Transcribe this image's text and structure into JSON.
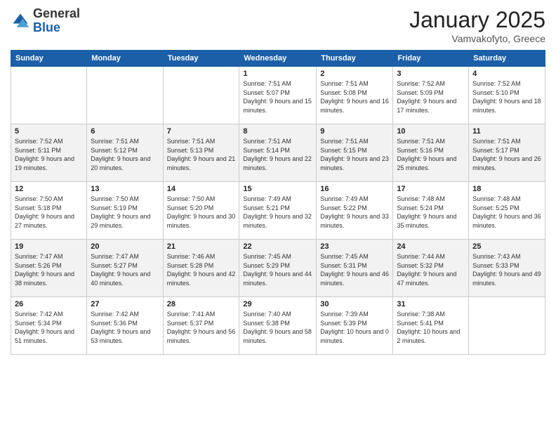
{
  "logo": {
    "general": "General",
    "blue": "Blue"
  },
  "title": "January 2025",
  "subtitle": "Vamvakofyto, Greece",
  "days_header": [
    "Sunday",
    "Monday",
    "Tuesday",
    "Wednesday",
    "Thursday",
    "Friday",
    "Saturday"
  ],
  "weeks": [
    [
      {
        "day": "",
        "sunrise": "",
        "sunset": "",
        "daylight": ""
      },
      {
        "day": "",
        "sunrise": "",
        "sunset": "",
        "daylight": ""
      },
      {
        "day": "",
        "sunrise": "",
        "sunset": "",
        "daylight": ""
      },
      {
        "day": "1",
        "sunrise": "Sunrise: 7:51 AM",
        "sunset": "Sunset: 5:07 PM",
        "daylight": "Daylight: 9 hours and 15 minutes."
      },
      {
        "day": "2",
        "sunrise": "Sunrise: 7:51 AM",
        "sunset": "Sunset: 5:08 PM",
        "daylight": "Daylight: 9 hours and 16 minutes."
      },
      {
        "day": "3",
        "sunrise": "Sunrise: 7:52 AM",
        "sunset": "Sunset: 5:09 PM",
        "daylight": "Daylight: 9 hours and 17 minutes."
      },
      {
        "day": "4",
        "sunrise": "Sunrise: 7:52 AM",
        "sunset": "Sunset: 5:10 PM",
        "daylight": "Daylight: 9 hours and 18 minutes."
      }
    ],
    [
      {
        "day": "5",
        "sunrise": "Sunrise: 7:52 AM",
        "sunset": "Sunset: 5:11 PM",
        "daylight": "Daylight: 9 hours and 19 minutes."
      },
      {
        "day": "6",
        "sunrise": "Sunrise: 7:51 AM",
        "sunset": "Sunset: 5:12 PM",
        "daylight": "Daylight: 9 hours and 20 minutes."
      },
      {
        "day": "7",
        "sunrise": "Sunrise: 7:51 AM",
        "sunset": "Sunset: 5:13 PM",
        "daylight": "Daylight: 9 hours and 21 minutes."
      },
      {
        "day": "8",
        "sunrise": "Sunrise: 7:51 AM",
        "sunset": "Sunset: 5:14 PM",
        "daylight": "Daylight: 9 hours and 22 minutes."
      },
      {
        "day": "9",
        "sunrise": "Sunrise: 7:51 AM",
        "sunset": "Sunset: 5:15 PM",
        "daylight": "Daylight: 9 hours and 23 minutes."
      },
      {
        "day": "10",
        "sunrise": "Sunrise: 7:51 AM",
        "sunset": "Sunset: 5:16 PM",
        "daylight": "Daylight: 9 hours and 25 minutes."
      },
      {
        "day": "11",
        "sunrise": "Sunrise: 7:51 AM",
        "sunset": "Sunset: 5:17 PM",
        "daylight": "Daylight: 9 hours and 26 minutes."
      }
    ],
    [
      {
        "day": "12",
        "sunrise": "Sunrise: 7:50 AM",
        "sunset": "Sunset: 5:18 PM",
        "daylight": "Daylight: 9 hours and 27 minutes."
      },
      {
        "day": "13",
        "sunrise": "Sunrise: 7:50 AM",
        "sunset": "Sunset: 5:19 PM",
        "daylight": "Daylight: 9 hours and 29 minutes."
      },
      {
        "day": "14",
        "sunrise": "Sunrise: 7:50 AM",
        "sunset": "Sunset: 5:20 PM",
        "daylight": "Daylight: 9 hours and 30 minutes."
      },
      {
        "day": "15",
        "sunrise": "Sunrise: 7:49 AM",
        "sunset": "Sunset: 5:21 PM",
        "daylight": "Daylight: 9 hours and 32 minutes."
      },
      {
        "day": "16",
        "sunrise": "Sunrise: 7:49 AM",
        "sunset": "Sunset: 5:22 PM",
        "daylight": "Daylight: 9 hours and 33 minutes."
      },
      {
        "day": "17",
        "sunrise": "Sunrise: 7:48 AM",
        "sunset": "Sunset: 5:24 PM",
        "daylight": "Daylight: 9 hours and 35 minutes."
      },
      {
        "day": "18",
        "sunrise": "Sunrise: 7:48 AM",
        "sunset": "Sunset: 5:25 PM",
        "daylight": "Daylight: 9 hours and 36 minutes."
      }
    ],
    [
      {
        "day": "19",
        "sunrise": "Sunrise: 7:47 AM",
        "sunset": "Sunset: 5:26 PM",
        "daylight": "Daylight: 9 hours and 38 minutes."
      },
      {
        "day": "20",
        "sunrise": "Sunrise: 7:47 AM",
        "sunset": "Sunset: 5:27 PM",
        "daylight": "Daylight: 9 hours and 40 minutes."
      },
      {
        "day": "21",
        "sunrise": "Sunrise: 7:46 AM",
        "sunset": "Sunset: 5:28 PM",
        "daylight": "Daylight: 9 hours and 42 minutes."
      },
      {
        "day": "22",
        "sunrise": "Sunrise: 7:45 AM",
        "sunset": "Sunset: 5:29 PM",
        "daylight": "Daylight: 9 hours and 44 minutes."
      },
      {
        "day": "23",
        "sunrise": "Sunrise: 7:45 AM",
        "sunset": "Sunset: 5:31 PM",
        "daylight": "Daylight: 9 hours and 46 minutes."
      },
      {
        "day": "24",
        "sunrise": "Sunrise: 7:44 AM",
        "sunset": "Sunset: 5:32 PM",
        "daylight": "Daylight: 9 hours and 47 minutes."
      },
      {
        "day": "25",
        "sunrise": "Sunrise: 7:43 AM",
        "sunset": "Sunset: 5:33 PM",
        "daylight": "Daylight: 9 hours and 49 minutes."
      }
    ],
    [
      {
        "day": "26",
        "sunrise": "Sunrise: 7:42 AM",
        "sunset": "Sunset: 5:34 PM",
        "daylight": "Daylight: 9 hours and 51 minutes."
      },
      {
        "day": "27",
        "sunrise": "Sunrise: 7:42 AM",
        "sunset": "Sunset: 5:36 PM",
        "daylight": "Daylight: 9 hours and 53 minutes."
      },
      {
        "day": "28",
        "sunrise": "Sunrise: 7:41 AM",
        "sunset": "Sunset: 5:37 PM",
        "daylight": "Daylight: 9 hours and 56 minutes."
      },
      {
        "day": "29",
        "sunrise": "Sunrise: 7:40 AM",
        "sunset": "Sunset: 5:38 PM",
        "daylight": "Daylight: 9 hours and 58 minutes."
      },
      {
        "day": "30",
        "sunrise": "Sunrise: 7:39 AM",
        "sunset": "Sunset: 5:39 PM",
        "daylight": "Daylight: 10 hours and 0 minutes."
      },
      {
        "day": "31",
        "sunrise": "Sunrise: 7:38 AM",
        "sunset": "Sunset: 5:41 PM",
        "daylight": "Daylight: 10 hours and 2 minutes."
      },
      {
        "day": "",
        "sunrise": "",
        "sunset": "",
        "daylight": ""
      }
    ]
  ]
}
